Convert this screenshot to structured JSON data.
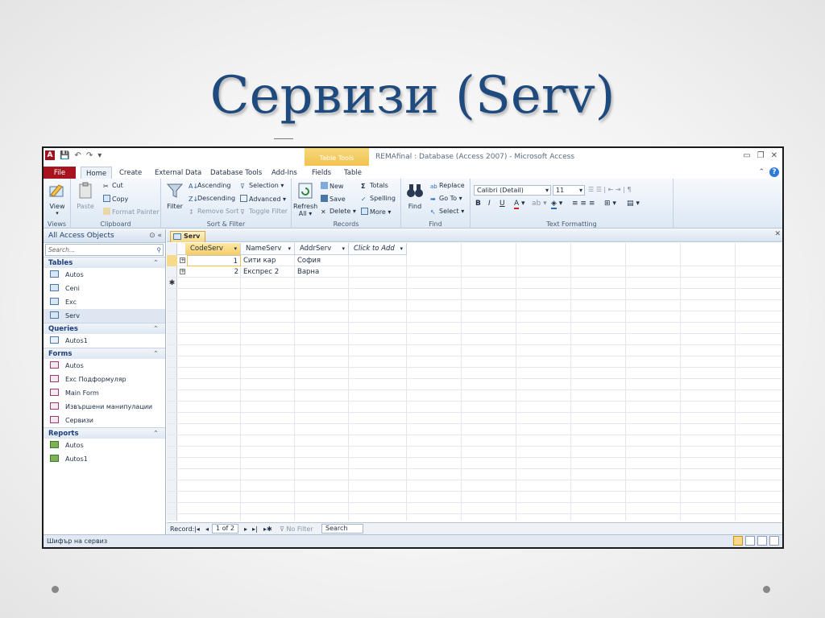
{
  "slide": {
    "title": "Сервизи (Serv)"
  },
  "app": {
    "context_tab": "Table Tools",
    "window_title": "REMAfinal : Database (Access 2007)  -  Microsoft Access"
  },
  "tabs": [
    "File",
    "Home",
    "Create",
    "External Data",
    "Database Tools",
    "Add-Ins",
    "Fields",
    "Table"
  ],
  "ribbon": {
    "views": {
      "view": "View",
      "label": "Views"
    },
    "clipboard": {
      "paste": "Paste",
      "cut": "Cut",
      "copy": "Copy",
      "format_painter": "Format Painter",
      "label": "Clipboard"
    },
    "sort_filter": {
      "filter": "Filter",
      "ascending": "Ascending",
      "descending": "Descending",
      "remove_sort": "Remove Sort",
      "selection": "Selection",
      "advanced": "Advanced",
      "toggle_filter": "Toggle Filter",
      "label": "Sort & Filter"
    },
    "records": {
      "refresh": "Refresh",
      "refresh_sub": "All",
      "new": "New",
      "save": "Save",
      "delete": "Delete",
      "totals": "Totals",
      "spelling": "Spelling",
      "more": "More",
      "label": "Records"
    },
    "find": {
      "find": "Find",
      "replace": "Replace",
      "goto": "Go To",
      "select": "Select",
      "label": "Find"
    },
    "text_formatting": {
      "font": "Calibri (Detail)",
      "size": "11",
      "label": "Text Formatting"
    }
  },
  "nav": {
    "header": "All Access Objects",
    "search_placeholder": "Search...",
    "groups": [
      {
        "name": "Tables",
        "items": [
          "Autos",
          "Ceni",
          "Exc",
          "Serv"
        ]
      },
      {
        "name": "Queries",
        "items": [
          "Autos1"
        ]
      },
      {
        "name": "Forms",
        "items": [
          "Autos",
          "Exc Подформуляр",
          "Main Form",
          "Извършени манипулации",
          "Сервизи"
        ]
      },
      {
        "name": "Reports",
        "items": [
          "Autos",
          "Autos1"
        ]
      }
    ]
  },
  "document": {
    "tab": "Serv",
    "columns": [
      "CodeServ",
      "NameServ",
      "AddrServ",
      "Click to Add"
    ],
    "rows": [
      {
        "code": "1",
        "name": "Сити кар",
        "addr": "София"
      },
      {
        "code": "2",
        "name": "Експрес 2",
        "addr": "Варна"
      }
    ]
  },
  "record_nav": {
    "label": "Record:",
    "position": "1 of 2",
    "filter": "No Filter",
    "search": "Search"
  },
  "status": {
    "text": "Шифър на сервиз"
  }
}
